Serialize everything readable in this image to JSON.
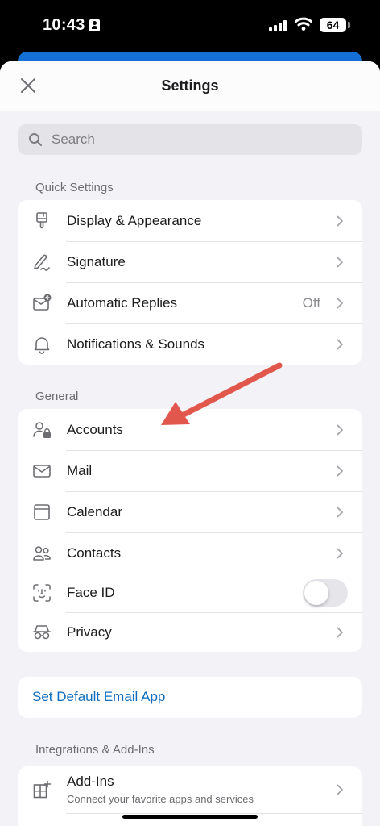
{
  "status_bar": {
    "time": "10:43",
    "battery": "64"
  },
  "nav": {
    "title": "Settings"
  },
  "search": {
    "placeholder": "Search"
  },
  "sections": {
    "quick": "Quick Settings",
    "general": "General",
    "integrations": "Integrations & Add-Ins"
  },
  "quick_items": [
    {
      "label": "Display & Appearance",
      "icon": "paintbrush-icon"
    },
    {
      "label": "Signature",
      "icon": "signature-pen-icon"
    },
    {
      "label": "Automatic Replies",
      "value": "Off",
      "icon": "auto-reply-icon"
    },
    {
      "label": "Notifications & Sounds",
      "icon": "bell-icon"
    }
  ],
  "general_items": [
    {
      "label": "Accounts",
      "icon": "account-lock-icon"
    },
    {
      "label": "Mail",
      "icon": "envelope-icon"
    },
    {
      "label": "Calendar",
      "icon": "calendar-icon"
    },
    {
      "label": "Contacts",
      "icon": "contacts-icon"
    },
    {
      "label": "Face ID",
      "icon": "face-id-icon",
      "toggle_on": false
    },
    {
      "label": "Privacy",
      "icon": "privacy-glasses-icon"
    }
  ],
  "default_email": "Set Default Email App",
  "integration_items": [
    {
      "label": "Add-Ins",
      "subtitle": "Connect your favorite apps and services",
      "icon": "add-ins-grid-icon"
    }
  ],
  "colors": {
    "link": "#0f6cbd",
    "background": "#f2f2f7",
    "annotation_arrow": "#e2574c",
    "header_blue": "#1570d6"
  }
}
